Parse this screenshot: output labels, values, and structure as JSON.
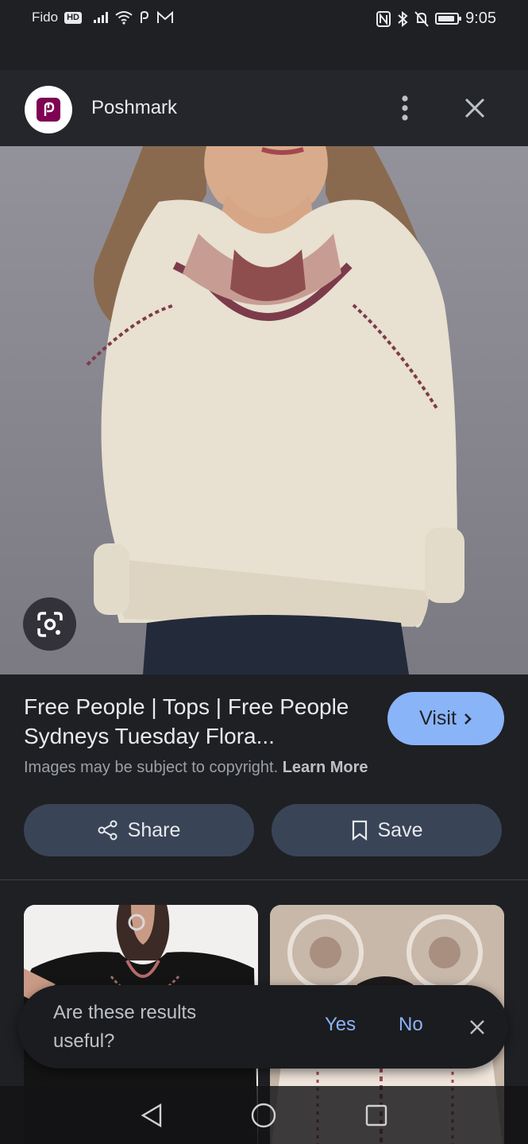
{
  "status_bar": {
    "carrier": "Fido",
    "network_badge": "HD",
    "time": "9:05",
    "battery_level": 0.9
  },
  "header": {
    "site_name": "Poshmark",
    "logo_icon": "poshmark-logo-icon",
    "logo_color": "#7f0353"
  },
  "info": {
    "title": "Free People | Tops | Free People Sydneys Tuesday Flora...",
    "visit_label": "Visit",
    "copyright_text": "Images may be subject to copyright.",
    "learn_more": "Learn More",
    "share_label": "Share",
    "save_label": "Save"
  },
  "feedback": {
    "question": "Are these results useful?",
    "yes_label": "Yes",
    "no_label": "No"
  },
  "colors": {
    "background": "#1f2024",
    "accent": "#8ab4f8",
    "pill": "#394457"
  }
}
